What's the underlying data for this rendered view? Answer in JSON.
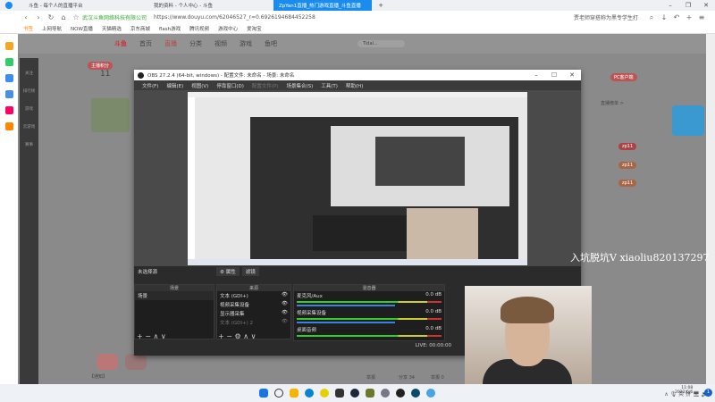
{
  "browser": {
    "tabs": [
      {
        "label": "斗鱼 - 每个人的直播平台"
      },
      {
        "label": "我的资料 - 个人中心 - 斗鱼"
      },
      {
        "label": "ZpYan1直播_热门游戏直播_斗鱼直播"
      }
    ],
    "site_name": "武汉斗鱼网络科技有限公司",
    "url": "https://www.douyu.com/62046527_r=0.6926194684452258",
    "search_text": "贾老师穿搭称为黑专学生打",
    "bookmarks": [
      "书签",
      "上网导航",
      "NOW直播",
      "天猫精选",
      "京东商城",
      "flash游戏",
      "腾讯视频",
      "游戏中心",
      "爱淘宝"
    ]
  },
  "douyu": {
    "nav": [
      "首页",
      "直播",
      "分类",
      "视频",
      "游戏",
      "鱼吧"
    ],
    "search_placeholder": "Tidal...",
    "left_nav": [
      "关注",
      "排行榜",
      "游戏",
      "云游戏",
      "赛事"
    ],
    "score_badge": "主播积分",
    "score": "11",
    "pc_client": "PC客户端",
    "rank": "直播榜单 >",
    "side_tags": [
      "zp11",
      "zp11",
      "zp11"
    ],
    "bottom_links": [
      "【通知】",
      "举报 0",
      "分享 34",
      "举报"
    ]
  },
  "obs": {
    "title": "OBS 27.2.4 (64-bit, windows) - 配置文件: 未命名 - 场景: 未命名",
    "menu": [
      "文件(F)",
      "编辑(E)",
      "视图(V)",
      "停靠窗口(D)",
      "配置文件(P)",
      "场景集合(S)",
      "工具(T)",
      "帮助(H)"
    ],
    "no_source": "未选择源",
    "properties": "属性",
    "filters": "滤镜",
    "panels": {
      "scenes": "场景",
      "sources": "来源",
      "mixer": "混音器"
    },
    "scenes": [
      "场景"
    ],
    "sources": [
      "文本 (GDI+)",
      "视频采集设备",
      "显示器采集",
      "文本 (GDI+) 2"
    ],
    "mixer": [
      {
        "name": "麦克风/Aux",
        "db": "0.0 dB"
      },
      {
        "name": "视频采集设备",
        "db": "0.0 dB"
      },
      {
        "name": "桌面音频",
        "db": "0.0 dB"
      }
    ],
    "status": "LIVE: 00:00:00"
  },
  "watermark": "入坑脱坑V xiaoliu820137297",
  "clock": {
    "time": "11:08",
    "date": "2022/6/6"
  },
  "notification_count": "1"
}
